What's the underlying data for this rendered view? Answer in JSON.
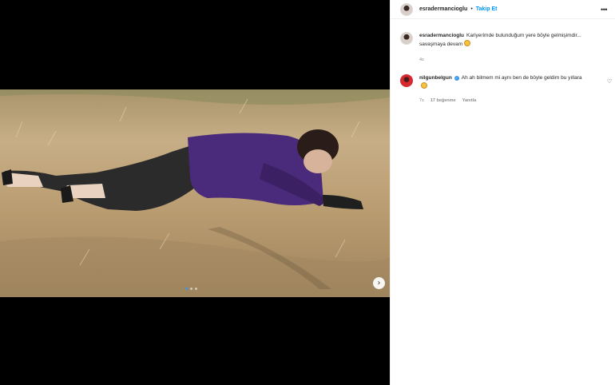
{
  "post": {
    "username": "esradermancioglu",
    "follow_label": "Takip Et",
    "dot": "•",
    "more_label": "•••",
    "next_arrow": "›",
    "carousel": {
      "count": 3,
      "active_index": 0
    }
  },
  "caption": {
    "username": "esradermancioglu",
    "text": "Kariyerimde bulunduğum yere böyle gelmişimdir... savaşmaya devam",
    "time": "4s"
  },
  "comments": [
    {
      "username": "nilgunbelgun",
      "verified": true,
      "text": "Ah ah bilmem mi aynı ben de böyle geldim bu yıllara",
      "time": "7s",
      "likes": "17 beğenme",
      "reply_label": "Yanıtla",
      "like_icon": "heart-icon"
    }
  ],
  "colors": {
    "accent": "#0095f6",
    "background_media": "#000000",
    "shirt": "#4a2a7a"
  }
}
